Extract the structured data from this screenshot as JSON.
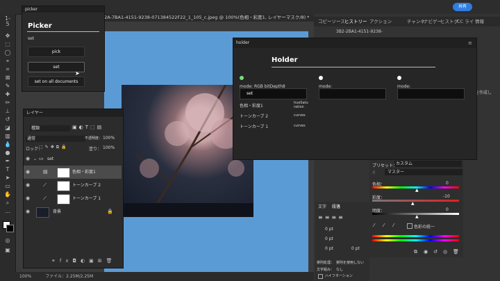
{
  "app": {
    "document_tab": "62A-7BA1-4151-9238-071384522F22_1_105_c.jpeg @ 100%(色相・彩度1, レイヤーマスク/8) *",
    "share_label": "共有",
    "zoom": "100%",
    "file_info": "ファイル：2.25M/2.25M",
    "ruler_mark": "1-5"
  },
  "picker": {
    "tab": "picker",
    "title": "Picker",
    "subtitle": "set",
    "buttons": [
      "pick",
      "set",
      "set on all documents"
    ]
  },
  "holder": {
    "tab": "holder",
    "title": "Holder",
    "columns": [
      {
        "mode": "mode: RGB bitDepth8",
        "set_label": "set",
        "active": true
      },
      {
        "mode": "mode:",
        "active": false
      },
      {
        "mode": "mode:",
        "active": false
      }
    ],
    "rows": [
      {
        "name": "色相・彩度1",
        "type": "hueSatu ration"
      },
      {
        "name": "トーンカーブ 2",
        "type": "curves"
      },
      {
        "name": "トーンカーブ 1",
        "type": "curves"
      }
    ]
  },
  "layers": {
    "tab": "レイヤー",
    "kind_filter": "種類",
    "blend_mode": "通常",
    "opacity_label": "不透明度：",
    "opacity": "100%",
    "lock_label": "ロック：",
    "fill_label": "塗り：",
    "fill": "100%",
    "items": [
      {
        "name": "set",
        "kind": "group"
      },
      {
        "name": "色相・彩度1",
        "kind": "adjustment",
        "selected": true
      },
      {
        "name": "トーンカーブ 2",
        "kind": "adjustment"
      },
      {
        "name": "トーンカーブ 1",
        "kind": "adjustment"
      },
      {
        "name": "背景",
        "kind": "background"
      }
    ]
  },
  "right": {
    "tabs": [
      "コピーソース",
      "ヒストリー",
      "アクション",
      "チャンネ",
      "ナビゲー",
      "ヒストグ",
      "CC ライ",
      "情報"
    ],
    "history_item": "3B2-2BA1-4151-9238-",
    "preset_label": "プリセット：",
    "preset_value": "カスタム",
    "channel": "マスター",
    "hue_label": "色相：",
    "hue_value": "0",
    "sat_label": "彩度：",
    "sat_value": "-10",
    "light_label": "明度：",
    "light_value": "0",
    "colorize": "色彩の統一",
    "char_tabs": [
      "文字",
      "段落"
    ],
    "pt_values": [
      "0 pt",
      "0 pt",
      "0 pt",
      "0 pt"
    ],
    "hyphen_label": "禁則処理：",
    "hyphen_value": "禁則を使用しない",
    "compose_label": "文字組み：",
    "compose_value": "なし",
    "hyphenation": "ハイフネーション",
    "action_hint": "を作成し"
  }
}
